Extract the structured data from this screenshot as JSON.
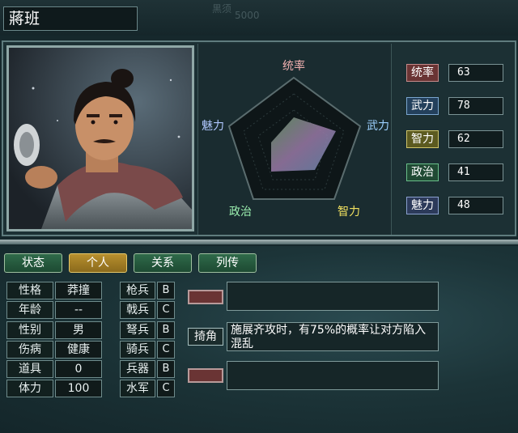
{
  "header": {
    "name": "蔣班"
  },
  "radar": {
    "labels": {
      "top": "统率",
      "right": "武力",
      "bottom_right": "智力",
      "bottom_left": "政治",
      "left": "魅力"
    },
    "label_colors": {
      "top": "#f0b0b0",
      "right": "#9cd0ff",
      "bottom_right": "#f0e060",
      "bottom_left": "#9cf0b0",
      "left": "#b0c8ff"
    }
  },
  "stats": [
    {
      "label": "统率",
      "value": "63",
      "bg": "#6a3434",
      "border": "#c48a8a"
    },
    {
      "label": "武力",
      "value": "78",
      "bg": "#23405c",
      "border": "#7aa6d0"
    },
    {
      "label": "智力",
      "value": "62",
      "bg": "#5c5a20",
      "border": "#cfc46a"
    },
    {
      "label": "政治",
      "value": "41",
      "bg": "#204a34",
      "border": "#6ac08a"
    },
    {
      "label": "魅力",
      "value": "48",
      "bg": "#2c3a5a",
      "border": "#8aa0d0"
    }
  ],
  "tabs": [
    "状态",
    "个人",
    "关系",
    "列传"
  ],
  "personal": [
    {
      "label": "性格",
      "value": "莽撞"
    },
    {
      "label": "年龄",
      "value": "--"
    },
    {
      "label": "性别",
      "value": "男"
    },
    {
      "label": "伤病",
      "value": "健康"
    },
    {
      "label": "道具",
      "value": "0"
    },
    {
      "label": "体力",
      "value": "100"
    }
  ],
  "troops": [
    {
      "label": "枪兵",
      "grade": "B"
    },
    {
      "label": "戟兵",
      "grade": "C"
    },
    {
      "label": "弩兵",
      "grade": "B"
    },
    {
      "label": "骑兵",
      "grade": "C"
    },
    {
      "label": "兵器",
      "grade": "B"
    },
    {
      "label": "水军",
      "grade": "C"
    }
  ],
  "skill": {
    "name": "掎角",
    "description": "施展齐攻时，有75%的概率让对方陷入混乱"
  },
  "background_text": {
    "ghost1": "黒须",
    "ghost2": "5000"
  }
}
